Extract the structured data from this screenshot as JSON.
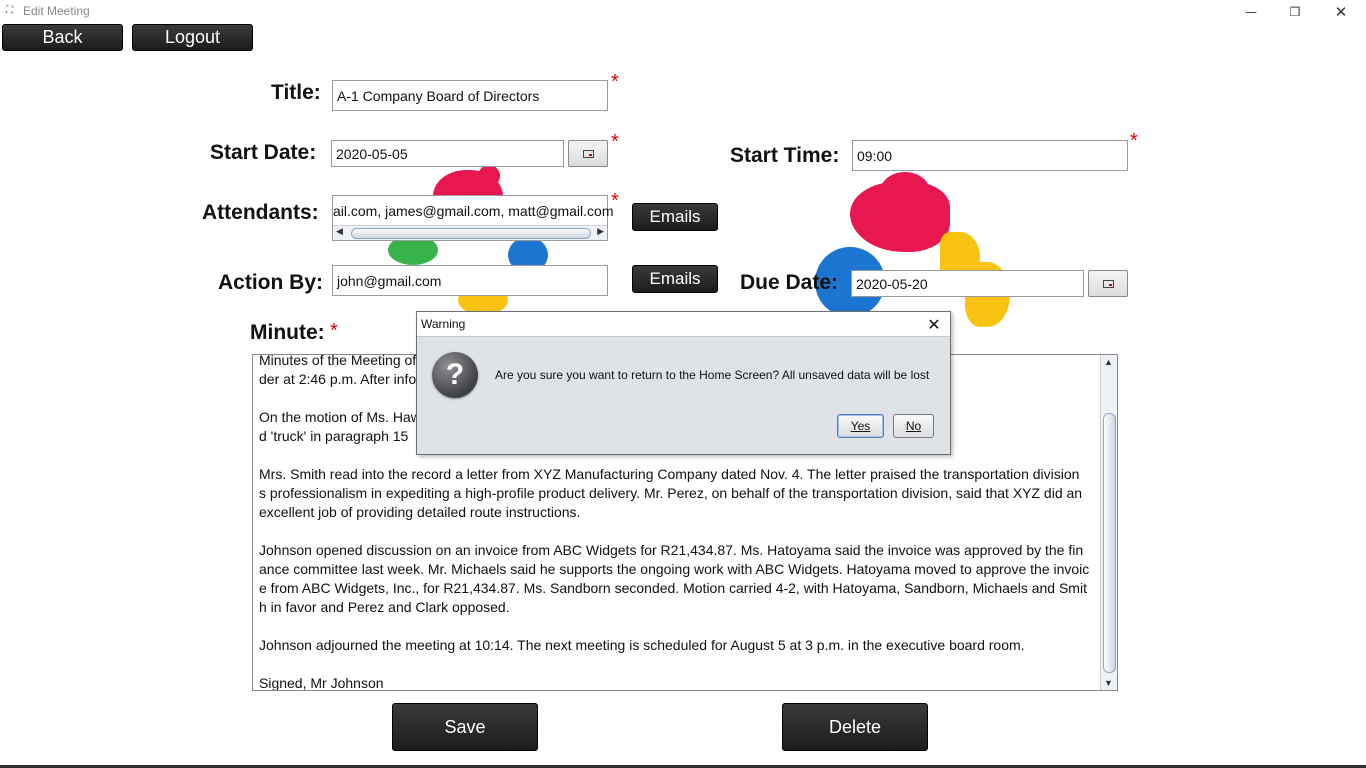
{
  "window": {
    "title": "Edit Meeting",
    "app_icon": "⛶",
    "minimize": "—",
    "restore": "❐",
    "close": "✕"
  },
  "toolbar": {
    "back_label": "Back",
    "logout_label": "Logout"
  },
  "form": {
    "required_mark": "*",
    "title_label": "Title:",
    "title_value": "A-1 Company Board of Directors",
    "start_date_label": "Start Date:",
    "start_date_value": "2020-05-05",
    "start_time_label": "Start Time:",
    "start_time_value": "09:00",
    "attendants_label": "Attendants:",
    "attendants_value": "ail.com, james@gmail.com, matt@gmail.com",
    "emails_label": "Emails",
    "action_by_label": "Action By:",
    "action_by_value": "john@gmail.com",
    "due_date_label": "Due Date:",
    "due_date_value": "2020-05-20",
    "minute_label": "Minute:"
  },
  "minutes": {
    "lines": [
      "Minutes of the Meeting of ... called the meeting to or",
      "der at 2:46 p.m. After info",
      "On the motion of Ms. Haw ... exception that the wor",
      "d 'truck' in paragraph 15",
      "Mrs. Smith read into the record a letter from XYZ Manufacturing Company dated Nov. 4. The letter praised the transportation division",
      "s professionalism in expediting a high-profile product delivery. Mr. Perez, on behalf of the transportation division, said that XYZ did an",
      " excellent job of providing detailed route instructions.",
      "Johnson opened discussion on an invoice from ABC Widgets for R21,434.87. Ms. Hatoyama said the invoice was approved by the fin",
      "ance committee last week. Mr. Michaels said he supports the ongoing work with ABC Widgets. Hatoyama moved to approve the invoic",
      "e from ABC Widgets, Inc., for R21,434.87. Ms. Sandborn seconded. Motion carried 4-2, with Hatoyama, Sandborn, Michaels and Smit",
      "h in favor and Perez and Clark opposed.",
      "Johnson adjourned the meeting at 10:14. The next meeting is scheduled for August 5 at 3 p.m. in the executive board room.",
      "Signed, Mr Johnson"
    ]
  },
  "actions": {
    "save_label": "Save",
    "delete_label": "Delete"
  },
  "dialog": {
    "title": "Warning",
    "close": "✕",
    "icon": "?",
    "message": "Are you sure you want to return to the Home Screen? All unsaved data will be lost",
    "yes_label": "Yes",
    "no_label": "No"
  }
}
